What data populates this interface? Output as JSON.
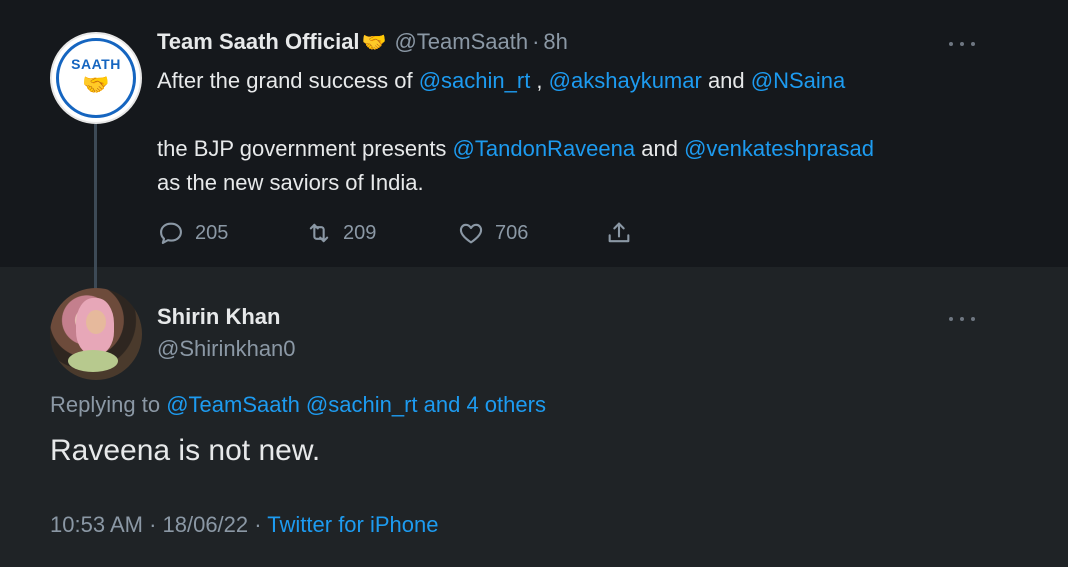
{
  "top_tweet": {
    "display_name": "Team Saath Official",
    "name_emoji": "🤝",
    "handle": "@TeamSaath",
    "separator": "·",
    "time": "8h",
    "avatar_text": "SAATH",
    "text": {
      "line1_prefix": "After the grand success of ",
      "mention1": "@sachin_rt",
      "line1_sep": " , ",
      "mention2": "@akshaykumar",
      "line1_and": " and ",
      "mention3": "@NSaina",
      "line2_prefix": "the BJP government presents ",
      "mention4": "@TandonRaveena",
      "line2_and": " and ",
      "mention5": "@venkateshprasad",
      "line3": "as the new saviors of India."
    },
    "stats": {
      "replies": "205",
      "retweets": "209",
      "likes": "706"
    }
  },
  "reply_tweet": {
    "display_name": "Shirin Khan",
    "handle": "@Shirinkhan0",
    "replying_prefix": "Replying to ",
    "replying_targets": "@TeamSaath @sachin_rt and 4 others",
    "text": "Raveena is not new.",
    "timestamp": "10:53 AM · 18/06/22 · ",
    "source": "Twitter for iPhone"
  },
  "colors": {
    "link": "#1d9bf0",
    "muted": "#8b98a5",
    "text": "#e7e9ea",
    "top_bg": "#15181c",
    "reply_bg": "#1f2326"
  },
  "icons": [
    "reply-icon",
    "retweet-icon",
    "like-icon",
    "share-icon",
    "more-icon",
    "handshake-icon"
  ]
}
